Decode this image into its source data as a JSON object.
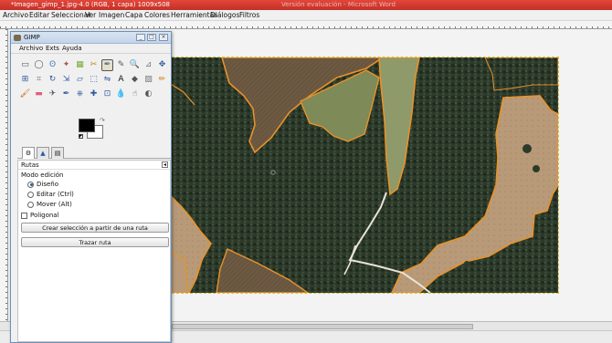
{
  "titlebar": {
    "title": "*Imagen_gimp_1.jpg-4.0 (RGB, 1 capa) 1009x508",
    "ghost": "Versión evaluación - Microsoft Word"
  },
  "menu": [
    "Archivo",
    "Editar",
    "Seleccionar",
    "Ver",
    "Imagen",
    "Capa",
    "Colores",
    "Herramientas",
    "Diálogos",
    "Filtros"
  ],
  "toolbox": {
    "title": "GIMP",
    "menu": [
      "Archivo",
      "Exts",
      "Ayuda"
    ],
    "buttons": [
      "_",
      "□",
      "×"
    ],
    "icons": [
      "rect-select",
      "ellipse-select",
      "free-select",
      "fuzzy-select",
      "by-color-select",
      "scissors-select",
      "paths",
      "color-picker",
      "zoom",
      "measure",
      "move",
      "align",
      "crop",
      "rotate",
      "scale",
      "shear",
      "perspective",
      "flip",
      "text",
      "bucket-fill",
      "blend",
      "pencil",
      "paintbrush",
      "eraser",
      "airbrush",
      "ink",
      "clone",
      "heal",
      "perspective-clone",
      "blur",
      "smudge",
      "dodge-burn"
    ],
    "selected_tool": "paths",
    "tool_glyphs": [
      "▭",
      "◯",
      "ʘ",
      "✦",
      "▦",
      "✂",
      "✒",
      "✎",
      "🔍",
      "⊿",
      "✥",
      "⊞",
      "⌗",
      "↻",
      "⇲",
      "▱",
      "⬚",
      "⇋",
      "A",
      "◆",
      "▨",
      "✏",
      "🖌",
      "▬",
      "✈",
      "✒",
      "⎈",
      "✚",
      "⊡",
      "💧",
      "☝",
      "◐"
    ],
    "tool_colors": [
      "#555",
      "#555",
      "#3a7ac0",
      "#a55",
      "#7a3",
      "#b8860b",
      "#3f6fb0",
      "#555",
      "#3a6fb0",
      "#777",
      "#2d5aa0",
      "#2d5aa0",
      "#777",
      "#2d5aa0",
      "#2d5aa0",
      "#2d5aa0",
      "#2d5aa0",
      "#2d5aa0",
      "#111",
      "#555",
      "#777",
      "#cc7a00",
      "#d35400",
      "#e06080",
      "#555",
      "#2d5aa0",
      "#2d5aa0",
      "#2d5aa0",
      "#2d5aa0",
      "#3a7ac0",
      "#555",
      "#555"
    ],
    "fg_color": "#000000",
    "bg_color": "#ffffff"
  },
  "options": {
    "panel_title": "Rutas",
    "mode_label": "Modo edición",
    "modes": [
      {
        "label": "Diseño",
        "checked": true
      },
      {
        "label": "Editar (Ctrl)",
        "checked": false
      },
      {
        "label": "Mover (Alt)",
        "checked": false
      }
    ],
    "polygonal_label": "Poligonal",
    "create_selection_button": "Crear selección a partir de una ruta",
    "stroke_path_button": "Trazar ruta"
  },
  "colors": {
    "accent_title": "#cf3b30",
    "selection_outline": "#e8922a"
  }
}
